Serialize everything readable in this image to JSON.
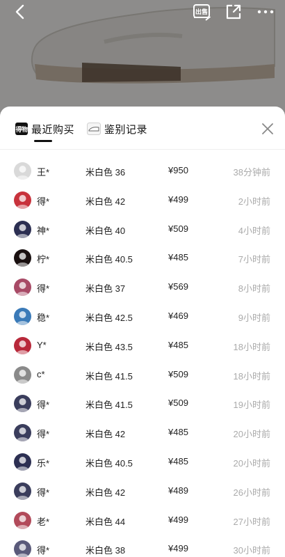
{
  "topbar": {
    "sell_label": "出售"
  },
  "tabs": {
    "recent": {
      "logo_text": "得物",
      "label": "最近购买"
    },
    "appraisal": {
      "label": "鉴别记录"
    }
  },
  "records": [
    {
      "user": "王*",
      "variant": "米白色 36",
      "price": "¥950",
      "time": "38分钟前",
      "avatar_color": "#d9d9d9"
    },
    {
      "user": "得*",
      "variant": "米白色 42",
      "price": "¥499",
      "time": "2小时前",
      "avatar_color": "#c8323c"
    },
    {
      "user": "神*",
      "variant": "米白色 40",
      "price": "¥509",
      "time": "4小时前",
      "avatar_color": "#2c2f52"
    },
    {
      "user": "柠*",
      "variant": "米白色 40.5",
      "price": "¥485",
      "time": "7小时前",
      "avatar_color": "#1a1010"
    },
    {
      "user": "得*",
      "variant": "米白色 37",
      "price": "¥569",
      "time": "8小时前",
      "avatar_color": "#a84a66"
    },
    {
      "user": "稳*",
      "variant": "米白色 42.5",
      "price": "¥469",
      "time": "9小时前",
      "avatar_color": "#3a7ab8"
    },
    {
      "user": "Y*",
      "variant": "米白色 43.5",
      "price": "¥485",
      "time": "18小时前",
      "avatar_color": "#b8283a"
    },
    {
      "user": "c*",
      "variant": "米白色 41.5",
      "price": "¥509",
      "time": "18小时前",
      "avatar_color": "#8a8a8a"
    },
    {
      "user": "得*",
      "variant": "米白色 41.5",
      "price": "¥509",
      "time": "19小时前",
      "avatar_color": "#3a3d5c"
    },
    {
      "user": "得*",
      "variant": "米白色 42",
      "price": "¥485",
      "time": "20小时前",
      "avatar_color": "#3a3d5c"
    },
    {
      "user": "乐*",
      "variant": "米白色 40.5",
      "price": "¥485",
      "time": "20小时前",
      "avatar_color": "#2c2f52"
    },
    {
      "user": "得*",
      "variant": "米白色 42",
      "price": "¥489",
      "time": "26小时前",
      "avatar_color": "#3a3d5c"
    },
    {
      "user": "老*",
      "variant": "米白色 44",
      "price": "¥499",
      "time": "27小时前",
      "avatar_color": "#b24a5a"
    },
    {
      "user": "得*",
      "variant": "米白色 38",
      "price": "¥499",
      "time": "30小时前",
      "avatar_color": "#5a5a7a"
    }
  ]
}
